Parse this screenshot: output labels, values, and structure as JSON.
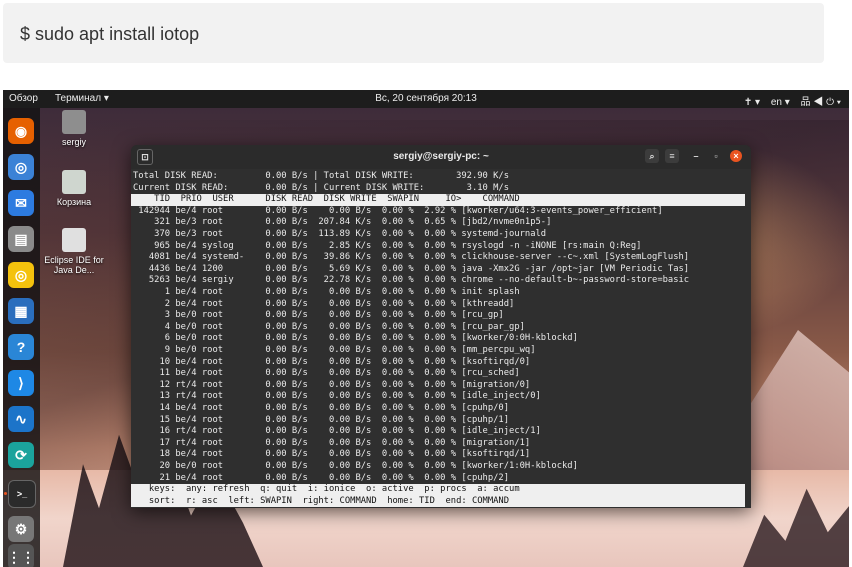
{
  "code": {
    "command": "$ sudo apt install iotop"
  },
  "topbar": {
    "activities": "Обзор",
    "app": "Терминал ▾",
    "clock": "Вс, 20 сентября 20:13",
    "tray": [
      "✝ ▾",
      "en ▾",
      "品 ◀ ⏻ ▾"
    ]
  },
  "dock": {
    "apps": [
      "firefox-icon",
      "chromium-icon",
      "thunderbird-icon",
      "files-icon",
      "rhythmbox-icon",
      "writer-icon",
      "help-icon",
      "vscode-icon",
      "monitor-icon",
      "network-icon",
      "terminal-icon",
      "settings-icon",
      "apps-grid-icon"
    ],
    "colors": [
      "#e66000",
      "#3b82d6",
      "#2d7be0",
      "#8a8a8a",
      "#f4c20d",
      "#2a6ebd",
      "#2a86d6",
      "#1e88e5",
      "#1c74c9",
      "#1ba39c",
      "#333333",
      "#777777",
      "#555555"
    ],
    "glyphs": [
      "◉",
      "◎",
      "✉",
      "▤",
      "◎",
      "▦",
      "?",
      "⟩",
      "∿",
      "⟳",
      ">_",
      "⚙",
      "⋮⋮"
    ]
  },
  "desktop_icons": [
    {
      "label": "sergiy"
    },
    {
      "label": "Корзина"
    },
    {
      "label": "Eclipse IDE for Java De..."
    }
  ],
  "terminal": {
    "title": "sergiy@sergiy-pc: ~",
    "lines": [
      "Total DISK READ:         0.00 B/s | Total DISK WRITE:        392.90 K/s",
      "Current DISK READ:       0.00 B/s | Current DISK WRITE:        3.10 M/s",
      "    TID  PRIO  USER      DISK READ  DISK WRITE  SWAPIN     IO>    COMMAND",
      " 142944 be/4 root        0.00 B/s    0.00 B/s  0.00 %  2.92 % [kworker/u64:3-events_power_efficient]",
      "    321 be/3 root        0.00 B/s  207.84 K/s  0.00 %  0.65 % [jbd2/nvme0n1p5-]",
      "    370 be/3 root        0.00 B/s  113.89 K/s  0.00 %  0.00 % systemd-journald",
      "    965 be/4 syslog      0.00 B/s    2.85 K/s  0.00 %  0.00 % rsyslogd -n -iNONE [rs:main Q:Reg]",
      "   4081 be/4 systemd-    0.00 B/s   39.86 K/s  0.00 %  0.00 % clickhouse-server --c~.xml [SystemLogFlush]",
      "   4436 be/4 1200        0.00 B/s    5.69 K/s  0.00 %  0.00 % java -Xmx2G -jar /opt~jar [VM Periodic Tas]",
      "   5263 be/4 sergiy      0.00 B/s   22.78 K/s  0.00 %  0.00 % chrome --no-default-b~-password-store=basic",
      "      1 be/4 root        0.00 B/s    0.00 B/s  0.00 %  0.00 % init splash",
      "      2 be/4 root        0.00 B/s    0.00 B/s  0.00 %  0.00 % [kthreadd]",
      "      3 be/0 root        0.00 B/s    0.00 B/s  0.00 %  0.00 % [rcu_gp]",
      "      4 be/0 root        0.00 B/s    0.00 B/s  0.00 %  0.00 % [rcu_par_gp]",
      "      6 be/0 root        0.00 B/s    0.00 B/s  0.00 %  0.00 % [kworker/0:0H-kblockd]",
      "      9 be/0 root        0.00 B/s    0.00 B/s  0.00 %  0.00 % [mm_percpu_wq]",
      "     10 be/4 root        0.00 B/s    0.00 B/s  0.00 %  0.00 % [ksoftirqd/0]",
      "     11 be/4 root        0.00 B/s    0.00 B/s  0.00 %  0.00 % [rcu_sched]",
      "     12 rt/4 root        0.00 B/s    0.00 B/s  0.00 %  0.00 % [migration/0]",
      "     13 rt/4 root        0.00 B/s    0.00 B/s  0.00 %  0.00 % [idle_inject/0]",
      "     14 be/4 root        0.00 B/s    0.00 B/s  0.00 %  0.00 % [cpuhp/0]",
      "     15 be/4 root        0.00 B/s    0.00 B/s  0.00 %  0.00 % [cpuhp/1]",
      "     16 rt/4 root        0.00 B/s    0.00 B/s  0.00 %  0.00 % [idle_inject/1]",
      "     17 rt/4 root        0.00 B/s    0.00 B/s  0.00 %  0.00 % [migration/1]",
      "     18 be/4 root        0.00 B/s    0.00 B/s  0.00 %  0.00 % [ksoftirqd/1]",
      "     20 be/0 root        0.00 B/s    0.00 B/s  0.00 %  0.00 % [kworker/1:0H-kblockd]",
      "     21 be/4 root        0.00 B/s    0.00 B/s  0.00 %  0.00 % [cpuhp/2]"
    ],
    "footer": [
      "   keys:  any: refresh  q: quit  i: ionice  o: active  p: procs  a: accum",
      "   sort:  r: asc  left: SWAPIN  right: COMMAND  home: TID  end: COMMAND"
    ]
  }
}
